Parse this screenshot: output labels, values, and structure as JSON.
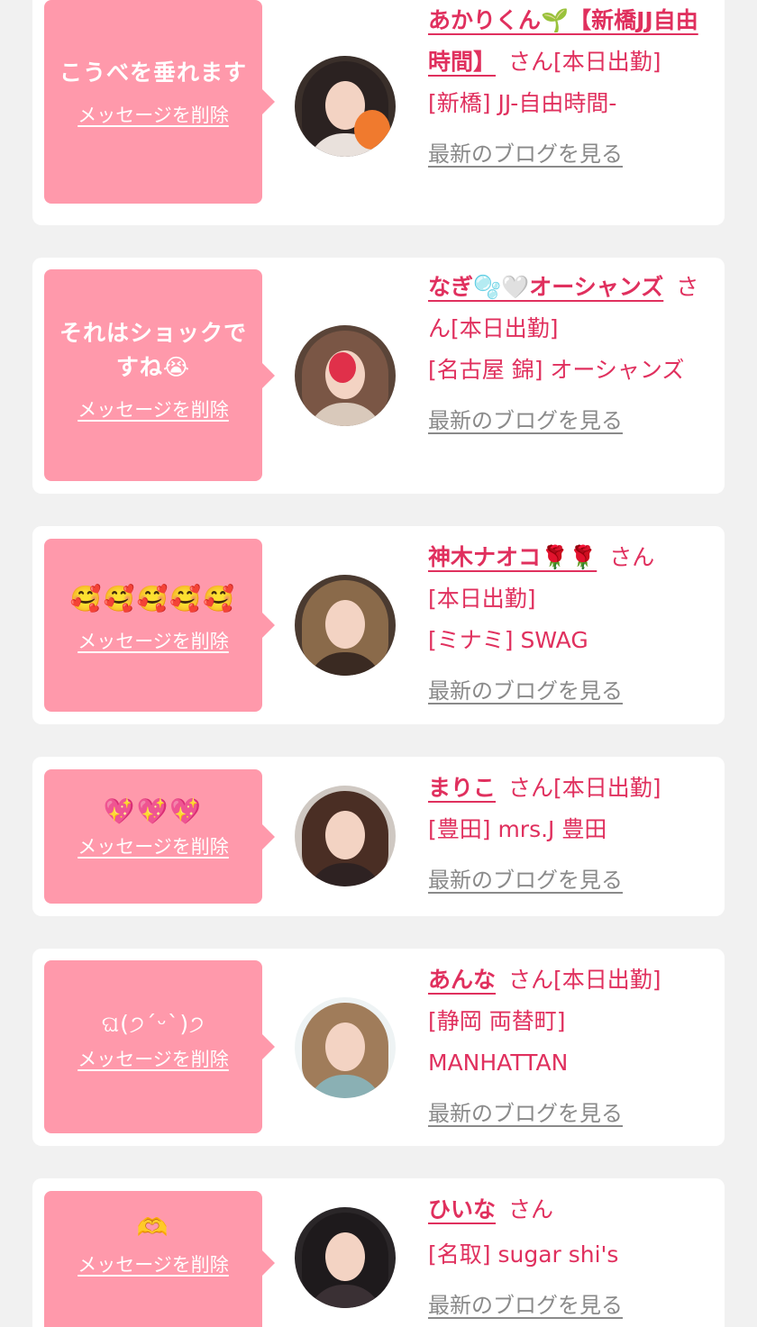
{
  "messages": [
    {
      "message": "こうべを垂れます",
      "delete_label": "メッセージを削除",
      "cast_name": "あかりくん🌱【新橋JJ自由時間】",
      "honorific": "さん",
      "shift": "[本日出勤]",
      "shop": "[新橋] JJ-自由時間-",
      "blog_link": "最新のブログを見る"
    },
    {
      "message": "それはショックですね😭",
      "delete_label": "メッセージを削除",
      "cast_name": "なぎ🫧🤍オーシャンズ",
      "honorific": "さん",
      "shift": "[本日出勤]",
      "shop": "[名古屋 錦] オーシャンズ",
      "blog_link": "最新のブログを見る"
    },
    {
      "message": "🥰🥰🥰🥰🥰",
      "delete_label": "メッセージを削除",
      "cast_name": "神木ナオコ🌹🌹",
      "honorific": "さん",
      "shift": "[本日出勤]",
      "shop": "[ミナミ] SWAG",
      "blog_link": "最新のブログを見る"
    },
    {
      "message": "💖💖💖",
      "delete_label": "メッセージを削除",
      "cast_name": "まりこ",
      "honorific": "さん",
      "shift": "[本日出勤]",
      "shop": "[豊田] mrs.J 豊田",
      "blog_link": "最新のブログを見る"
    },
    {
      "message": "ଘ(੭ˊᵕˋ)੭",
      "delete_label": "メッセージを削除",
      "cast_name": "あんな",
      "honorific": "さん",
      "shift": "[本日出勤]",
      "shop": "[静岡 両替町] MANHATTAN",
      "blog_link": "最新のブログを見る"
    },
    {
      "message": "🫶",
      "delete_label": "メッセージを削除",
      "cast_name": "ひいな",
      "honorific": "さん",
      "shift": "",
      "shop": "[名取] sugar shi's",
      "blog_link": "最新のブログを見る"
    }
  ],
  "colors": {
    "page_background": "#f1f1f1",
    "card_background": "#ffffff",
    "bubble": "#ff99ab",
    "accent_text": "#e0305e",
    "link_gray": "#8a8a8a"
  }
}
